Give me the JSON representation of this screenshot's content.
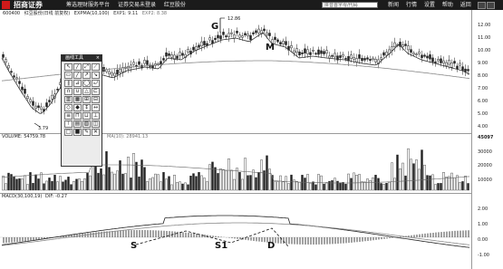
{
  "app": {
    "brand": "招商证券",
    "menu": [
      "筹选理财服务平台",
      "证券交易未登录",
      "红豆股份"
    ],
    "search_placeholder": "拼音首字母/代码",
    "right_menu": [
      "新闻",
      "行情",
      "设置",
      "帮助",
      "返回"
    ]
  },
  "chart_info": {
    "code": "600400",
    "name": "红豆股份(日线 前复权)",
    "ma_label": "EXPMA(10,100)",
    "exp1": "EXP1: 9.11",
    "exp2": "EXP2: 8.38"
  },
  "price_axis": [
    "12.00",
    "11.00",
    "10.00",
    "9.00",
    "8.00",
    "7.00",
    "6.00",
    "5.00",
    "4.00"
  ],
  "annotations": {
    "high_value": "12.86",
    "low_value": "3.79",
    "G": "G",
    "M": "M",
    "S": "S",
    "S1": "S1",
    "D": "D"
  },
  "volume_info": {
    "label": "VOLUME: 54759.78",
    "ma_label": "MA(10): 28941.13"
  },
  "volume_axis": [
    "45097",
    "30000",
    "20000",
    "10000"
  ],
  "macd_info": {
    "label": "MACD(30,100,19)",
    "dif": "DIF: -0.27"
  },
  "macd_axis": [
    "2.00",
    "1.00",
    "0.00",
    "-1.00"
  ],
  "tool_panel": {
    "title": "画线工具",
    "close": "×",
    "tools": [
      "↖",
      "╱",
      "⤢",
      "⟋",
      "▭",
      "╱",
      "↗",
      "↘",
      "∥",
      "⊿",
      "◯",
      "⤾",
      "∩",
      "∪",
      "△",
      "⊏",
      "▥",
      "▦",
      "⊞",
      "⊟",
      "◇",
      "◆",
      "↕",
      "↔",
      "≡",
      "⊓",
      "⊔",
      "⊥",
      "⊤",
      "▤",
      "▨",
      "◫",
      "□",
      "■",
      "✎",
      "✕"
    ]
  },
  "colors": {
    "titlebar": "#1b1b1b",
    "candle": "#222222",
    "ma1": "#333333",
    "ma2": "#888888"
  }
}
